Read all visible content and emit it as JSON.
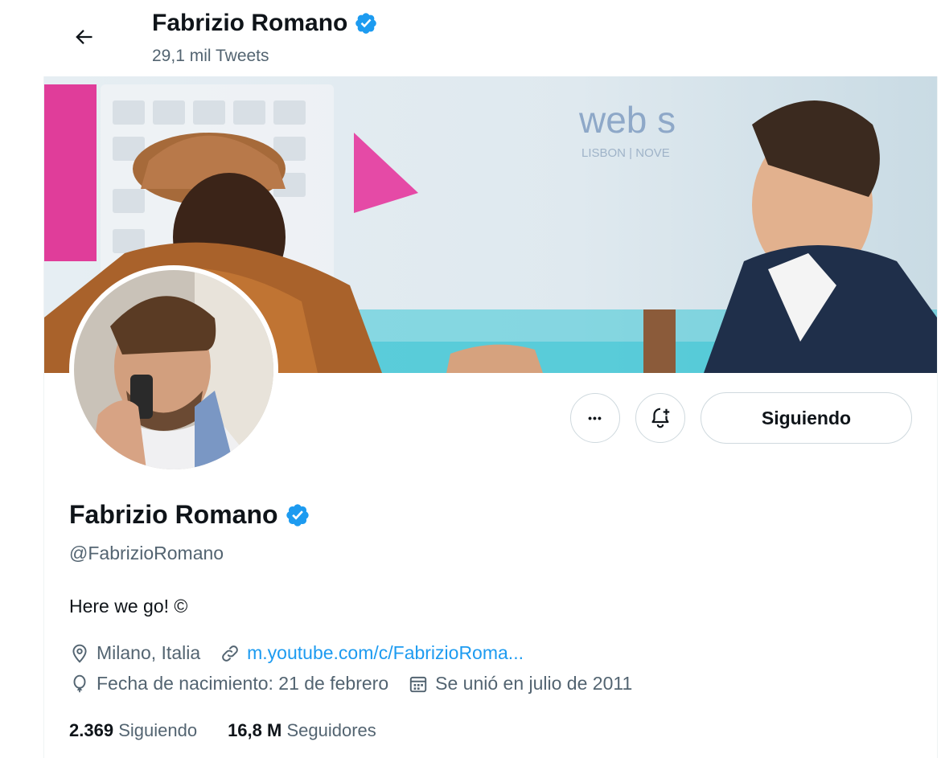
{
  "header": {
    "title": "Fabrizio Romano",
    "tweet_count": "29,1 mil Tweets"
  },
  "banner": {
    "logo_text": "web s",
    "logo_sub": "LISBON | NOVE"
  },
  "actions": {
    "more_label": "•••",
    "follow_label": "Siguiendo"
  },
  "profile": {
    "name": "Fabrizio Romano",
    "handle": "@FabrizioRomano",
    "bio": "Here we go! ©",
    "location": "Milano, Italia",
    "website": "m.youtube.com/c/FabrizioRoma...",
    "birthday": "Fecha de nacimiento: 21 de febrero",
    "joined": "Se unió en julio de 2011"
  },
  "stats": {
    "following_count": "2.369",
    "following_label": "Siguiendo",
    "followers_count": "16,8 M",
    "followers_label": "Seguidores"
  },
  "colors": {
    "accent": "#1d9bf0",
    "secondary_text": "#536471",
    "primary_text": "#0f1419",
    "border": "#cfd9de"
  },
  "icons": {
    "back": "arrow-left-icon",
    "verified": "verified-badge-icon",
    "notify": "bell-plus-icon",
    "location": "location-pin-icon",
    "link": "link-icon",
    "birthday": "balloon-icon",
    "calendar": "calendar-icon"
  }
}
